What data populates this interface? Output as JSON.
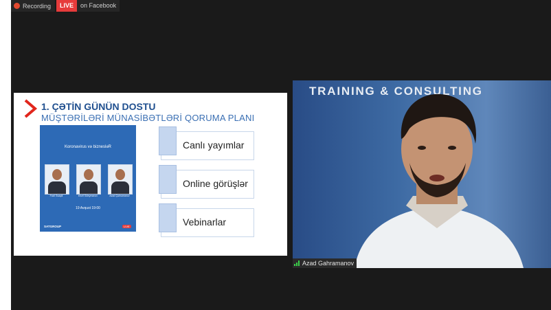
{
  "recording_bar": {
    "recording_label": "Recording",
    "live_badge": "LIVE",
    "platform_label": "on Facebook"
  },
  "slide": {
    "title_line1": "1. ÇƏTİN GÜNÜN DOSTU",
    "title_line2": "MÜŞTƏRİLƏRİ MÜNASİBƏTLƏRİ QORUMA PLANI",
    "poster": {
      "title": "Koronavirus və biznesləR",
      "speakers": [
        "Fazil Ssaqili",
        "Elsrif Süleymanov",
        "Azad Qəhrəmanov"
      ],
      "date": "19 Avqust 19:00",
      "logo": "SATGROUP",
      "live": "LIVE"
    },
    "items": [
      "Canlı yayımlar",
      "Online görüşlər",
      "Vebinarlar"
    ]
  },
  "video": {
    "banner_text": "TRAINING & CONSULTING",
    "participant_name": "Azad Gahramanov"
  },
  "colors": {
    "background": "#1a1a1a",
    "live_red": "#e63b3b",
    "title_blue": "#1f4f8f",
    "accent_red": "#e1261c",
    "tile_blue": "#c5d6ef"
  }
}
